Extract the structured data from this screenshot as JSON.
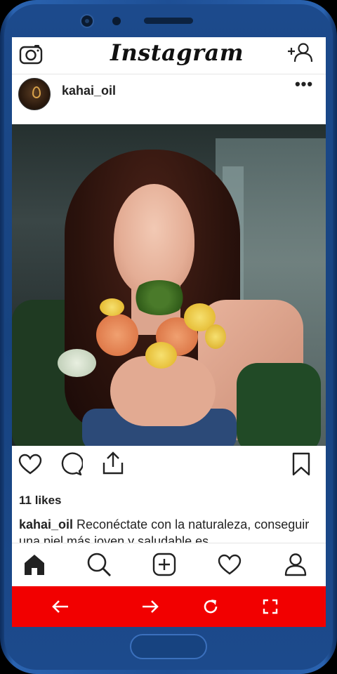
{
  "app": {
    "logo_text": "Instagram"
  },
  "topbar": {
    "left_icon": "camera-icon",
    "right_icon": "add-user-icon"
  },
  "post": {
    "username": "kahai_oil",
    "more_label": "•••",
    "likes_text": "11 likes",
    "caption_user": "kahai_oil",
    "caption_text": " Reconéctate con la naturaleza, conseguir una piel más joven y saludable es"
  },
  "actions": [
    "heart-icon",
    "comment-icon",
    "share-icon",
    "bookmark-icon"
  ],
  "bottom_nav": [
    "home-icon",
    "search-icon",
    "add-post-icon",
    "activity-heart-icon",
    "profile-icon"
  ],
  "browser_bar": {
    "background": "#f20000",
    "icons": [
      "back-arrow-icon",
      "forward-arrow-icon",
      "reload-icon",
      "fullscreen-icon"
    ]
  },
  "colors": {
    "phone_frame": "#1e4f95",
    "text": "#222222"
  }
}
